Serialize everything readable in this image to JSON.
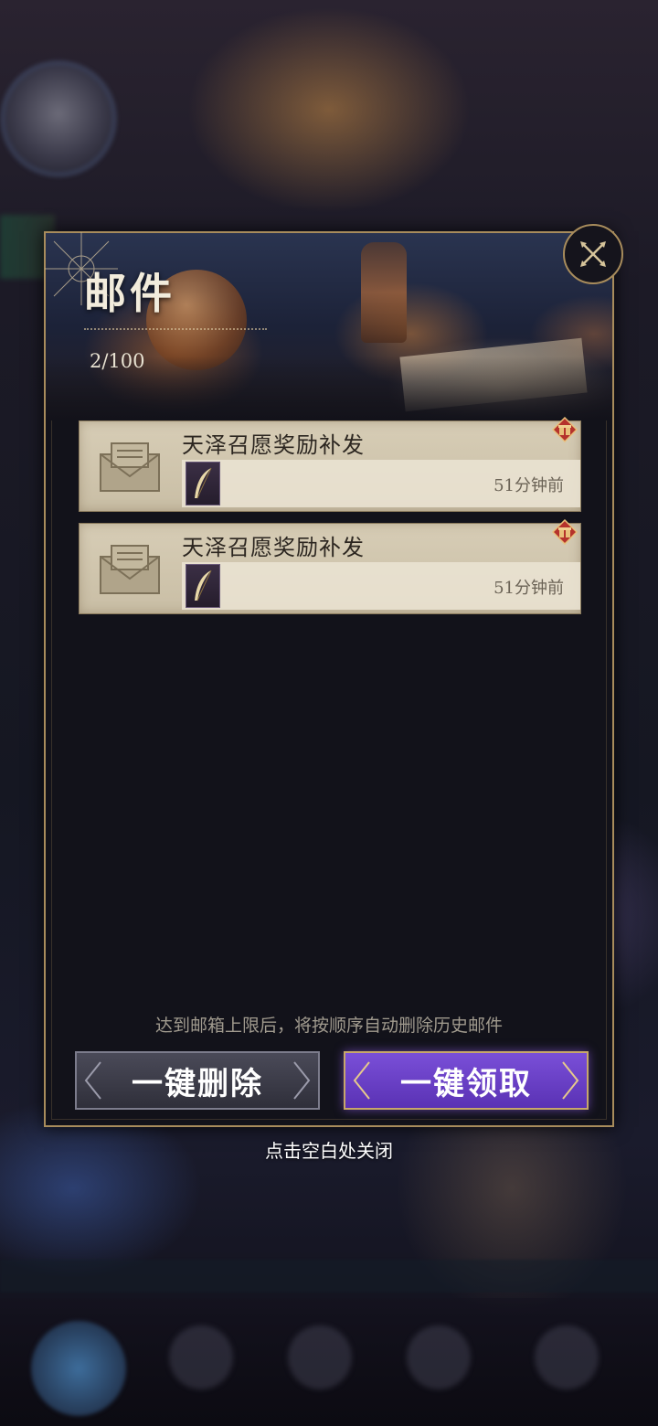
{
  "dialog": {
    "title": "邮件",
    "counter": "2/100",
    "close_icon": "close-x-icon"
  },
  "mails": [
    {
      "title": "天泽召愿奖励补发",
      "time": "51分钟前",
      "icon": "envelope-icon",
      "item_icon": "feather-quill-icon",
      "badge_icon": "gift-icon"
    },
    {
      "title": "天泽召愿奖励补发",
      "time": "51分钟前",
      "icon": "envelope-icon",
      "item_icon": "feather-quill-icon",
      "badge_icon": "gift-icon"
    }
  ],
  "footer": {
    "hint": "达到邮箱上限后，将按顺序自动删除历史邮件",
    "delete_all_label": "一键删除",
    "claim_all_label": "一键领取"
  },
  "close_hint": "点击空白处关闭",
  "colors": {
    "panel_border": "#a88c5c",
    "claim_button": "#6a40c8",
    "delete_button": "#3c3c48",
    "mail_card": "#d2c8b0"
  }
}
